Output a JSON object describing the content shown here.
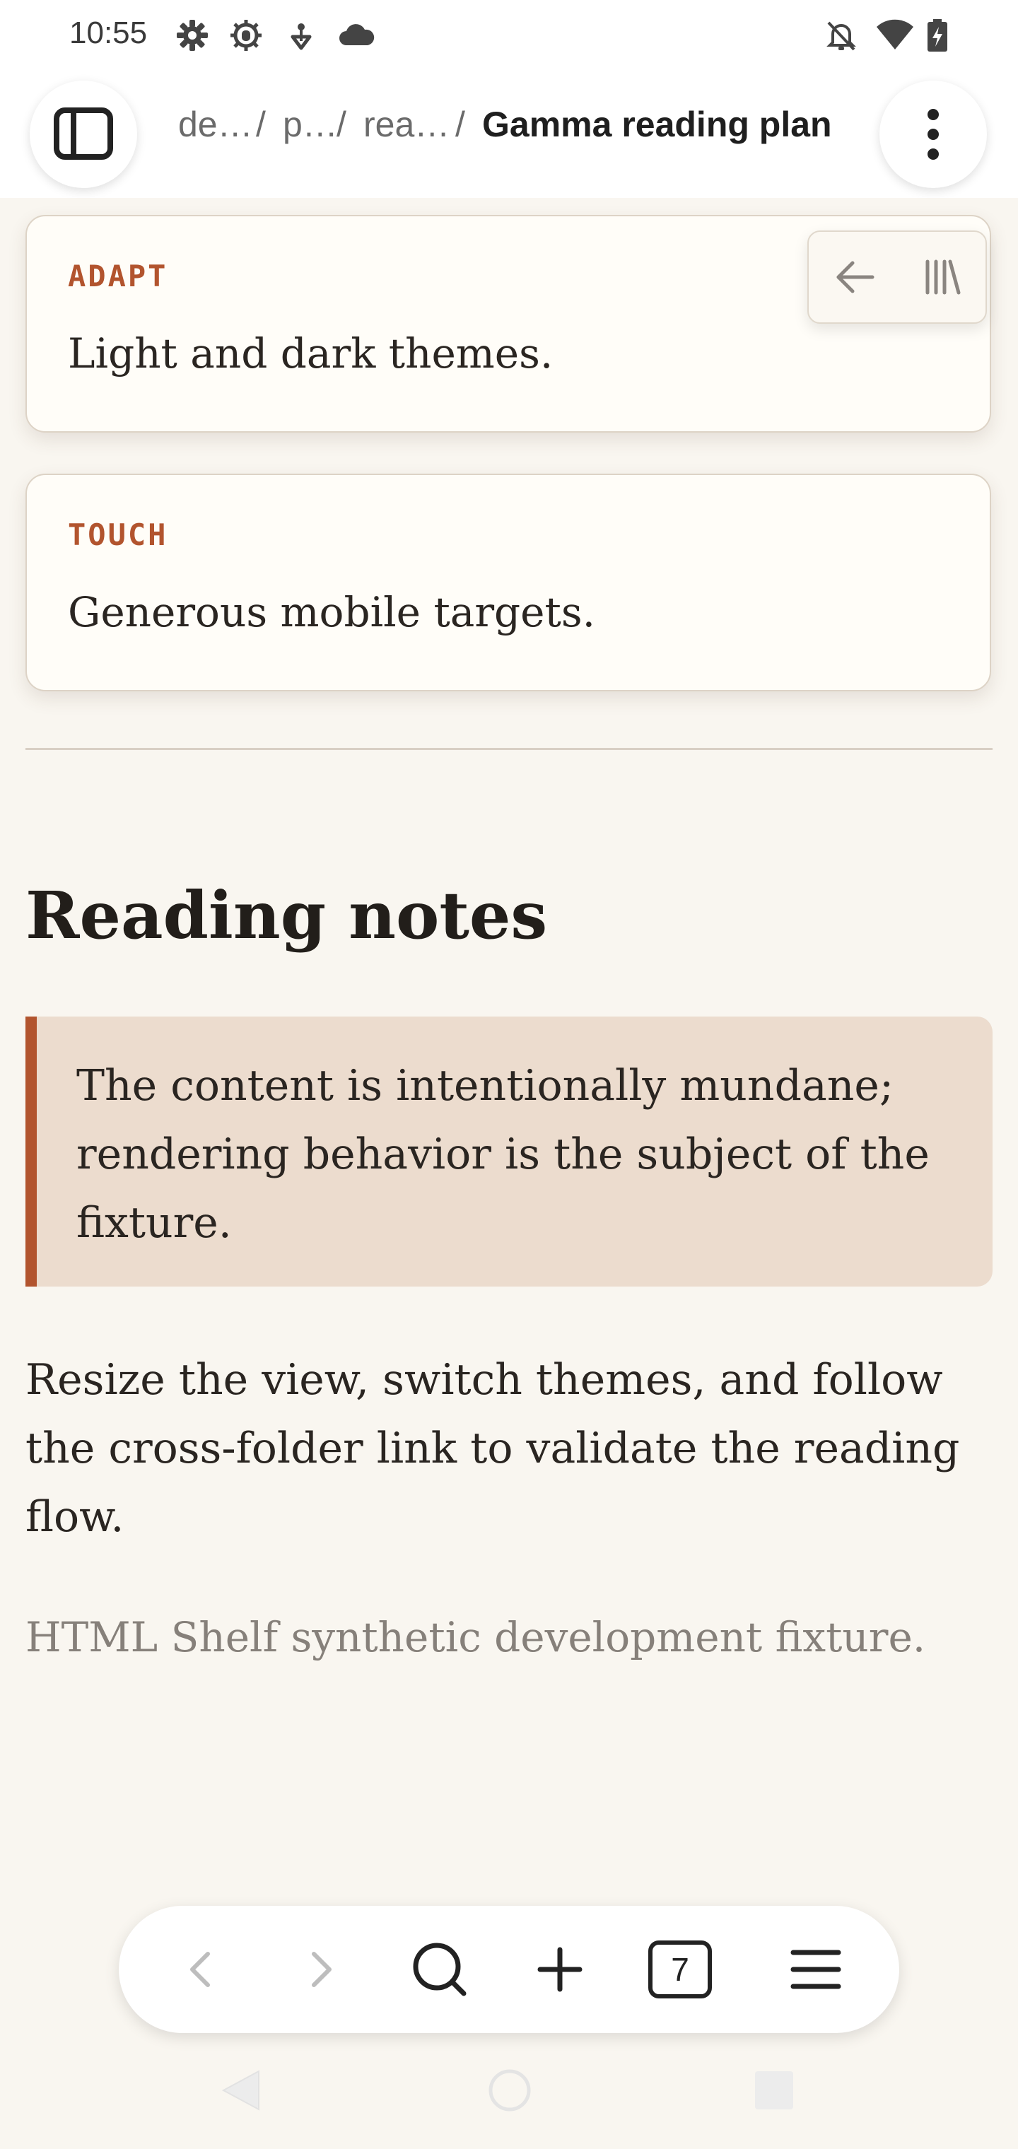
{
  "status_bar": {
    "time": "10:55",
    "left_icons": [
      "gear-icon",
      "bug-gear-icon",
      "usb-debug-icon",
      "cloud-icon"
    ],
    "right_icons": [
      "bell-off-icon",
      "wifi-icon",
      "battery-charging-icon"
    ]
  },
  "top_bar": {
    "sidebar_toggle_icon": "sidebar-icon",
    "breadcrumbs": [
      "de…",
      "p…",
      "rea…"
    ],
    "separator": "/",
    "current_page": "Gamma reading plan",
    "menu_icon": "more-vertical-icon"
  },
  "floating_tools": {
    "back_icon": "arrow-left-icon",
    "library_icon": "library-icon"
  },
  "content": {
    "cards": [
      {
        "label": "ADAPT",
        "text": "Light and dark themes."
      },
      {
        "label": "TOUCH",
        "text": "Generous mobile targets."
      }
    ],
    "heading": "Reading notes",
    "blockquote": "The content is intentionally mundane; rendering behavior is the subject of the fixture.",
    "paragraph": "Resize the view, switch themes, and follow the cross-folder link to validate the reading flow.",
    "footer": "HTML Shelf synthetic development fixture."
  },
  "browser_toolbar": {
    "back_icon": "chevron-left-icon",
    "forward_icon": "chevron-right-icon",
    "search_icon": "search-icon",
    "new_tab_icon": "plus-icon",
    "tab_count": "7",
    "menu_icon": "hamburger-icon"
  },
  "system_nav": {
    "back": "triangle-back-icon",
    "home": "circle-home-icon",
    "recents": "square-recents-icon"
  },
  "colors": {
    "accent": "#b2542e",
    "page_background": "#f9f6f0",
    "card_background": "#fffdf8",
    "quote_background": "#ecdcce"
  }
}
